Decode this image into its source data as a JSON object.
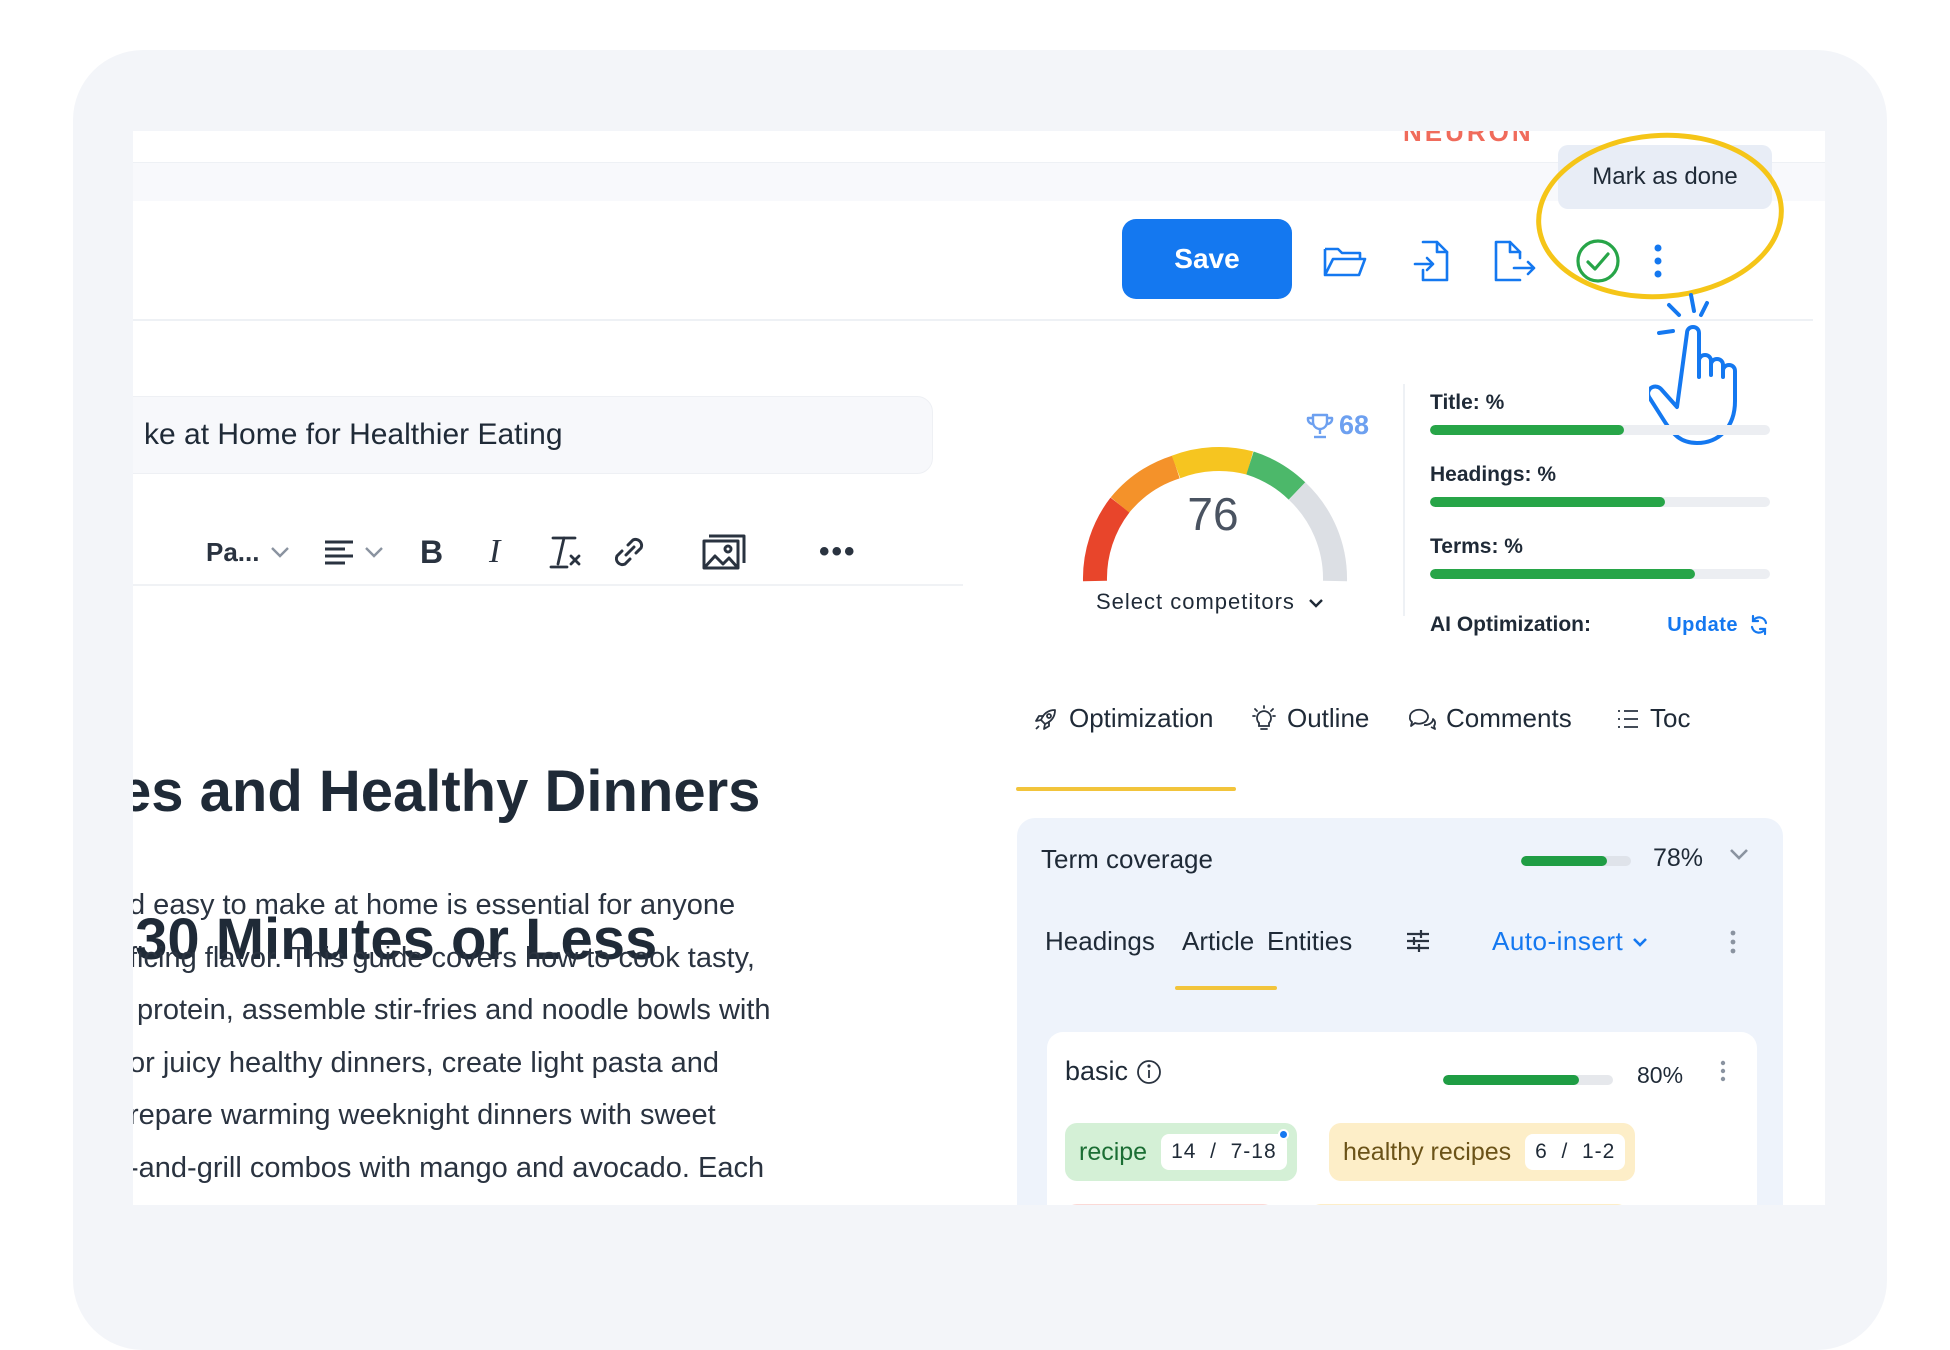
{
  "app": {
    "brand": "NEURON"
  },
  "toolbar": {
    "tooltip": "Mark as done",
    "save_label": "Save",
    "icons": [
      "folder-open-icon",
      "import-document-icon",
      "export-document-icon",
      "check-circle-icon",
      "more-vertical-icon"
    ]
  },
  "editor": {
    "title_value": "ke at Home for Healthier Eating",
    "format_paragraph_label": "Pa...",
    "heading_lines": [
      "es and Healthy Dinners",
      " 30 Minutes or Less"
    ],
    "paragraph_lines": [
      "d easy to make at home is essential for anyone",
      "ficing flavor. This guide covers how to cook tasty,",
      " protein, assemble stir-fries and noodle bowls with",
      "or juicy healthy dinners, create light pasta and",
      "repare warming weeknight dinners with sweet",
      "-and-grill combos with mango and avocado. Each"
    ]
  },
  "score": {
    "value": "76",
    "competitor_score": "68",
    "select_competitors_label": "Select competitors",
    "colors": {
      "red": "#e8452b",
      "orange": "#f4922a",
      "yellow": "#f6c520",
      "green": "#4cb86a",
      "gray": "#dcdfe4"
    }
  },
  "metrics": [
    {
      "label": "Title: %",
      "value": 0.57
    },
    {
      "label": "Headings: %",
      "value": 0.69
    },
    {
      "label": "Terms: %",
      "value": 0.78
    }
  ],
  "ai_optimization": {
    "label": "AI Optimization:",
    "action": "Update"
  },
  "tabs": [
    {
      "label": "Optimization",
      "icon": "rocket-icon",
      "active": true
    },
    {
      "label": "Outline",
      "icon": "lightbulb-icon",
      "active": false
    },
    {
      "label": "Comments",
      "icon": "comments-icon",
      "active": false
    },
    {
      "label": "Toc",
      "icon": "list-icon",
      "active": false
    }
  ],
  "coverage": {
    "title": "Term coverage",
    "percent_label": "78%",
    "percent": 78,
    "subtabs": [
      "Headings",
      "Article",
      "Entities"
    ],
    "active_subtab": "Article",
    "auto_insert_label": "Auto-insert"
  },
  "basic": {
    "title": "basic",
    "percent_label": "80%",
    "percent": 80,
    "chips": [
      {
        "term": "recipe",
        "count": "14  /  7-18",
        "bg": "#d4f0d6",
        "fg": "#1b6e34"
      },
      {
        "term": "healthy recipes",
        "count": "6  /  1-2",
        "bg": "#fdeec8",
        "fg": "#6b5318"
      }
    ]
  }
}
